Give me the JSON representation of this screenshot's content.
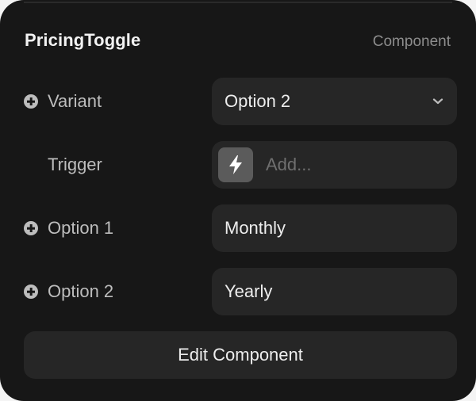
{
  "header": {
    "title": "PricingToggle",
    "kind": "Component"
  },
  "properties": {
    "variant": {
      "label": "Variant",
      "value": "Option 2"
    },
    "trigger": {
      "label": "Trigger",
      "placeholder": "Add..."
    },
    "option1": {
      "label": "Option 1",
      "value": "Monthly"
    },
    "option2": {
      "label": "Option 2",
      "value": "Yearly"
    }
  },
  "actions": {
    "edit_label": "Edit Component"
  },
  "icons": {
    "add": "plus-circle-icon",
    "dropdown": "chevron-down-icon",
    "trigger": "lightning-bolt-icon"
  },
  "colors": {
    "panel_bg": "#171717",
    "field_bg": "#262626",
    "label_text": "#bdbdbd",
    "muted_text": "#8d8d8d"
  }
}
